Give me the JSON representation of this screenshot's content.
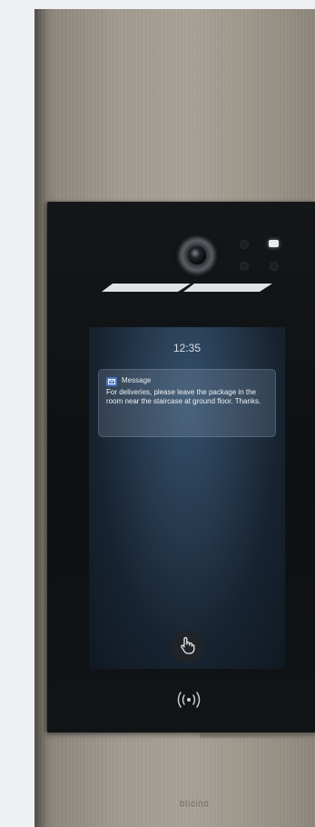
{
  "screen": {
    "time": "12:35",
    "notification": {
      "title": "Message",
      "icon": "message-icon",
      "body": "For deliveries, please leave the package in the room near the staircase at ground floor. Thanks."
    }
  },
  "controls": {
    "touch_icon": "hand-pointer-icon",
    "nfc_icon": "nfc-icon"
  },
  "brand": {
    "name": "bticino"
  },
  "colors": {
    "panel": "#a09a90",
    "front": "#121517",
    "screen_glow": "#34506b",
    "notification_icon": "#4a78c4"
  }
}
